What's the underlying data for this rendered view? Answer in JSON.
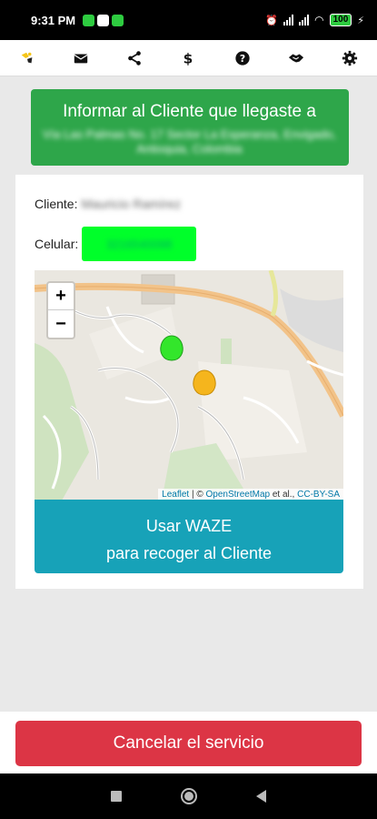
{
  "status_bar": {
    "time": "9:31 PM",
    "battery": "100"
  },
  "toolbar": {
    "icons": [
      "logo-icon",
      "mail-icon",
      "share-icon",
      "dollar-icon",
      "help-icon",
      "handshake-icon",
      "gear-icon"
    ]
  },
  "banner": {
    "title": "Informar al Cliente que llegaste a",
    "address": "Vía Las Palmas No. 17 Sector La Esperanza, Envigado, Antioquia, Colombia"
  },
  "client": {
    "label": "Cliente:",
    "name": "Mauricio Ramírez",
    "phone_label": "Celular:",
    "phone": "3216540098"
  },
  "map": {
    "zoom_in": "+",
    "zoom_out": "−",
    "attribution_leaflet": "Leaflet",
    "attribution_sep": "| ©",
    "attribution_osm": "OpenStreetMap",
    "attribution_etal": "et al.,",
    "attribution_license": "CC-BY-SA",
    "marker_colors": {
      "driver": "#33e62b",
      "client": "#f5b51d"
    }
  },
  "waze_button": {
    "line1": "Usar WAZE",
    "line2": "para recoger al Cliente"
  },
  "cancel_button": {
    "label": "Cancelar el servicio"
  },
  "colors": {
    "banner": "#2ea64a",
    "waze": "#17a2b8",
    "cancel": "#dc3545",
    "phone_box": "#00ff2a"
  }
}
